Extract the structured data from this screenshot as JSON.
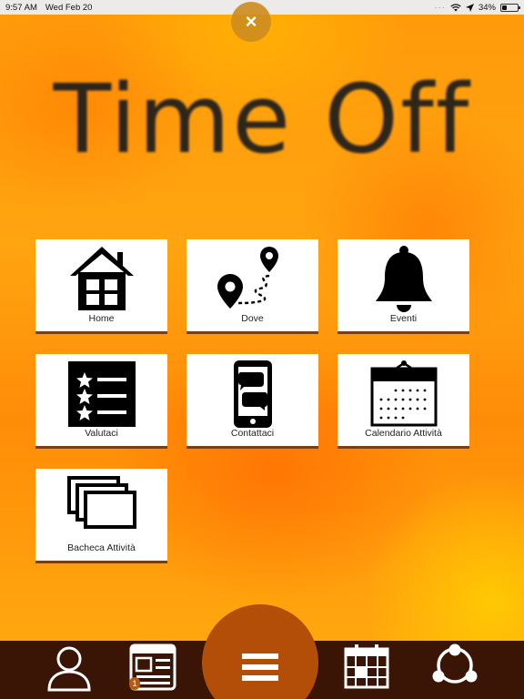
{
  "status_bar": {
    "time": "9:57 AM",
    "date": "Wed Feb 20",
    "battery": "34%",
    "battery_level": 0.34
  },
  "close_button": {
    "label": "×"
  },
  "app": {
    "title": "Time Off"
  },
  "menu": {
    "items": [
      {
        "label": "Home",
        "icon": "house-icon"
      },
      {
        "label": "Dove",
        "icon": "map-route-icon"
      },
      {
        "label": "Eventi",
        "icon": "bell-icon"
      },
      {
        "label": "Valutaci",
        "icon": "star-list-icon"
      },
      {
        "label": "Contattaci",
        "icon": "phone-chat-icon"
      },
      {
        "label": "Calendario Attività",
        "icon": "calendar-icon"
      },
      {
        "label": "Bacheca Attività",
        "icon": "stacked-boards-icon"
      }
    ]
  },
  "bottom_nav": {
    "items": [
      "user-icon",
      "news-icon",
      "menu-icon",
      "calendar-icon",
      "share-icon"
    ],
    "news_badge": "1"
  },
  "colors": {
    "bottom_bar": "#3a1404",
    "menu_circle": "#b24e08",
    "tile_border": "#7a3e10"
  }
}
